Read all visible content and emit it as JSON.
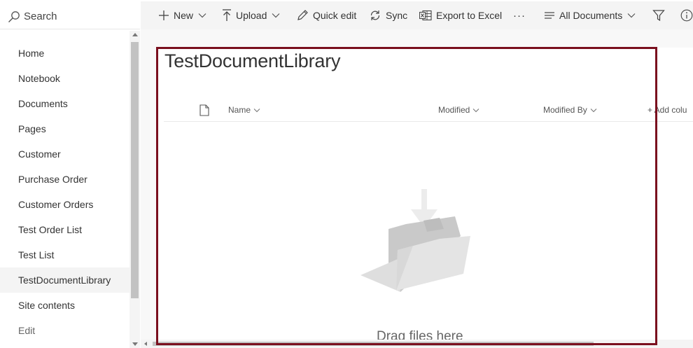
{
  "search": {
    "label": "Search",
    "icon": "search-icon"
  },
  "nav": {
    "items": [
      {
        "label": "Home"
      },
      {
        "label": "Notebook"
      },
      {
        "label": "Documents"
      },
      {
        "label": "Pages"
      },
      {
        "label": "Customer"
      },
      {
        "label": "Purchase Order"
      },
      {
        "label": "Customer Orders"
      },
      {
        "label": "Test Order List"
      },
      {
        "label": "Test List"
      },
      {
        "label": "TestDocumentLibrary"
      },
      {
        "label": "Site contents"
      },
      {
        "label": "Edit"
      }
    ],
    "selected": "TestDocumentLibrary"
  },
  "toolbar": {
    "new_label": "New",
    "upload_label": "Upload",
    "quick_edit_label": "Quick edit",
    "sync_label": "Sync",
    "export_label": "Export to Excel",
    "more_label": "···",
    "view_label": "All Documents"
  },
  "library": {
    "title": "TestDocumentLibrary",
    "columns": {
      "name": "Name",
      "modified": "Modified",
      "modified_by": "Modified By",
      "add_column": "+ Add colu"
    },
    "empty_text": "Drag files here"
  },
  "colors": {
    "highlight_border": "#7a0f1e",
    "toolbar_bg": "#f4f4f4",
    "selected_nav_bg": "#f4f4f4"
  }
}
